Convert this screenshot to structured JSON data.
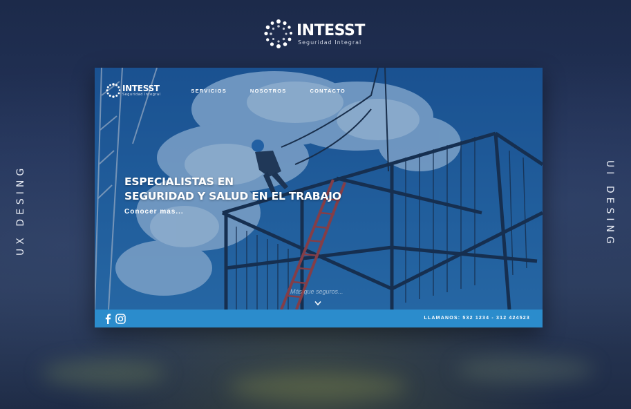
{
  "brand": {
    "name": "INTESST",
    "tagline": "Seguridad Integral"
  },
  "side_labels": {
    "left": "UX DESING",
    "right": "UI DESING"
  },
  "site": {
    "logo": {
      "name": "INTESST",
      "tagline": "Seguridad Integral"
    },
    "nav": [
      {
        "label": "SERVICIOS"
      },
      {
        "label": "NOSOTROS"
      },
      {
        "label": "CONTACTO"
      }
    ],
    "hero": {
      "headline_line1": "ESPECIALISTAS EN",
      "headline_line2": "SEGURIDAD Y SALUD EN EL TRABAJO",
      "cta": "Conocer mas...",
      "scroll_hint": "Más que seguros..."
    },
    "footer": {
      "social": [
        "facebook-icon",
        "instagram-icon"
      ],
      "phone": "LLAMANOS: 532 1234 - 312 424523"
    }
  },
  "colors": {
    "background": "#1f2d4d",
    "accent_blue": "#2b8ccc",
    "text": "#ffffff"
  }
}
